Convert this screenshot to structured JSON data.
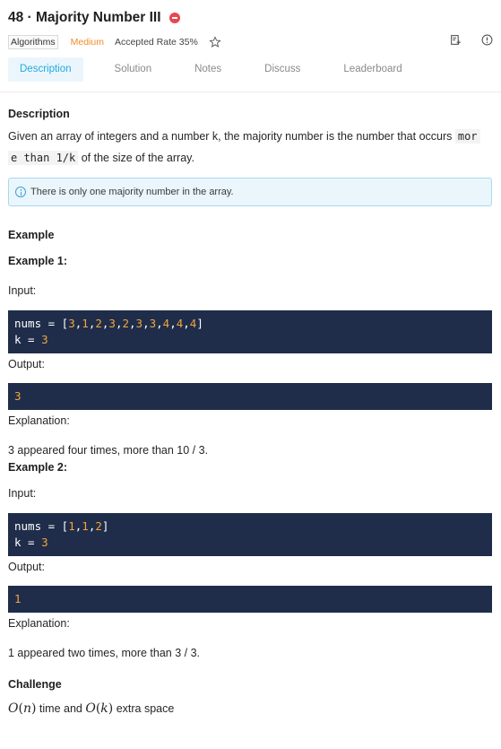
{
  "problem": {
    "title": "48 · Majority Number III",
    "tag": "Algorithms",
    "difficulty": "Medium",
    "accepted_rate": "Accepted Rate 35%"
  },
  "tabs": [
    "Description",
    "Solution",
    "Notes",
    "Discuss",
    "Leaderboard"
  ],
  "description": {
    "heading": "Description",
    "text_before": "Given an array of integers and a number k, the majority number is the number that occurs ",
    "code_line1": "mor",
    "code_line2": "e than 1/k",
    "text_after": " of the size of the array.",
    "note": "There is only one majority number in the array."
  },
  "example": {
    "heading": "Example",
    "ex1": {
      "title": "Example 1:",
      "input_label": "Input:",
      "nums_prefix": "nums = [",
      "nums": [
        "3",
        "1",
        "2",
        "3",
        "2",
        "3",
        "3",
        "4",
        "4",
        "4"
      ],
      "k_prefix": "k = ",
      "k": "3",
      "output_label": "Output:",
      "output": "3",
      "explanation_label": "Explanation:",
      "explanation": "3 appeared four times, more than 10 / 3."
    },
    "ex2": {
      "title": "Example 2:",
      "input_label": "Input:",
      "nums_prefix": "nums = [",
      "nums": [
        "1",
        "1",
        "2"
      ],
      "k_prefix": "k = ",
      "k": "3",
      "output_label": "Output:",
      "output": "1",
      "explanation_label": "Explanation:",
      "explanation": "1 appeared two times, more than 3 / 3."
    }
  },
  "challenge": {
    "heading": "Challenge",
    "o1": "O",
    "n": "n",
    "o2": "O",
    "k": "k",
    "time_text": " time and ",
    "space_text": " extra space"
  },
  "colors": {
    "accent": "#24a8e0",
    "difficulty": "#f08c2a",
    "code_bg": "#1f2d4a",
    "code_number": "#f3a53b",
    "status_dot": "#e8484e"
  },
  "icons": [
    "minus-circle-icon",
    "star-icon",
    "note-edit-icon",
    "info-circle-icon"
  ]
}
